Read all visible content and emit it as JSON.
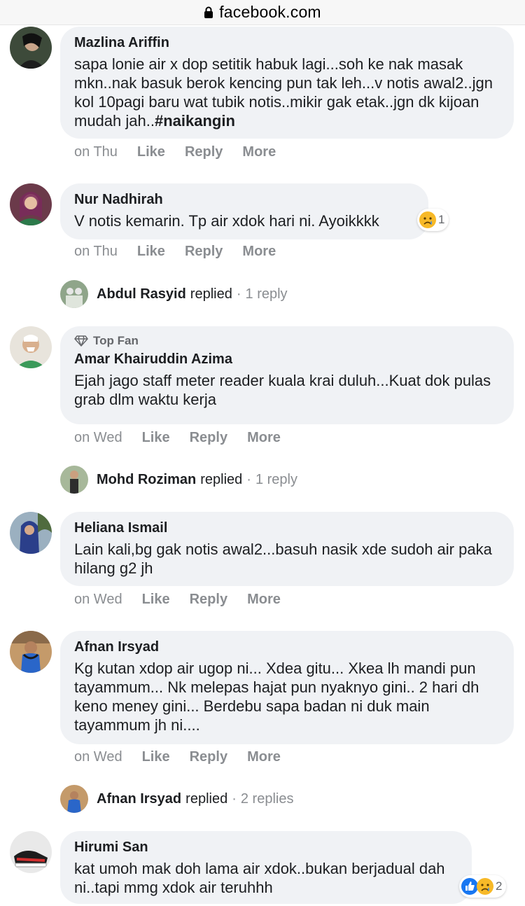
{
  "browser": {
    "domain": "facebook.com"
  },
  "comments": [
    {
      "name": "Mazlina Ariffin",
      "text": "sapa lonie air x dop setitik habuk lagi...soh ke nak masak mkn..nak basuk berok kencing pun tak leh...v notis awal2..jgn kol 10pagi baru wat tubik notis..mikir gak etak..jgn dk kijoan mudah jah..",
      "hashtag": "#naikangin",
      "time": "on Thu",
      "like": "Like",
      "reply": "Reply",
      "more": "More"
    },
    {
      "name": "Nur Nadhirah",
      "text": "V notis kemarin. Tp air xdok hari ni. Ayoikkkk",
      "reaction_count": "1",
      "time": "on Thu",
      "like": "Like",
      "reply": "Reply",
      "more": "More",
      "replied_name": "Abdul Rasyid",
      "replied_word": "replied",
      "replied_count": "1 reply"
    },
    {
      "badge": "Top Fan",
      "name": "Amar Khairuddin Azima",
      "text": "Ejah jago staff meter reader kuala krai duluh...Kuat dok pulas grab dlm waktu kerja",
      "time": "on Wed",
      "like": "Like",
      "reply": "Reply",
      "more": "More",
      "replied_name": "Mohd Roziman",
      "replied_word": "replied",
      "replied_count": "1 reply"
    },
    {
      "name": "Heliana Ismail",
      "text": "Lain kali,bg gak notis awal2...basuh nasik xde sudoh air paka hilang g2 jh",
      "time": "on Wed",
      "like": "Like",
      "reply": "Reply",
      "more": "More"
    },
    {
      "name": "Afnan Irsyad",
      "text": "Kg kutan xdop air ugop ni... Xdea gitu... Xkea lh mandi pun tayammum... Nk melepas hajat pun nyaknyo gini.. 2 hari dh keno meney gini... Berdebu sapa badan ni duk main tayammum jh ni....",
      "time": "on Wed",
      "like": "Like",
      "reply": "Reply",
      "more": "More",
      "replied_name": "Afnan Irsyad",
      "replied_word": "replied",
      "replied_count": "2 replies"
    },
    {
      "name": "Hirumi San",
      "text": "kat umoh mak doh lama air xdok..bukan berjadual dah ni..tapi mmg xdok air teruhhh",
      "reaction_count": "2"
    }
  ],
  "separator": "·",
  "colors": {
    "bubble": "#f0f2f5",
    "meta": "#8a8d91",
    "like_blue": "#1877f2",
    "sad_yellow": "#f7b928"
  }
}
